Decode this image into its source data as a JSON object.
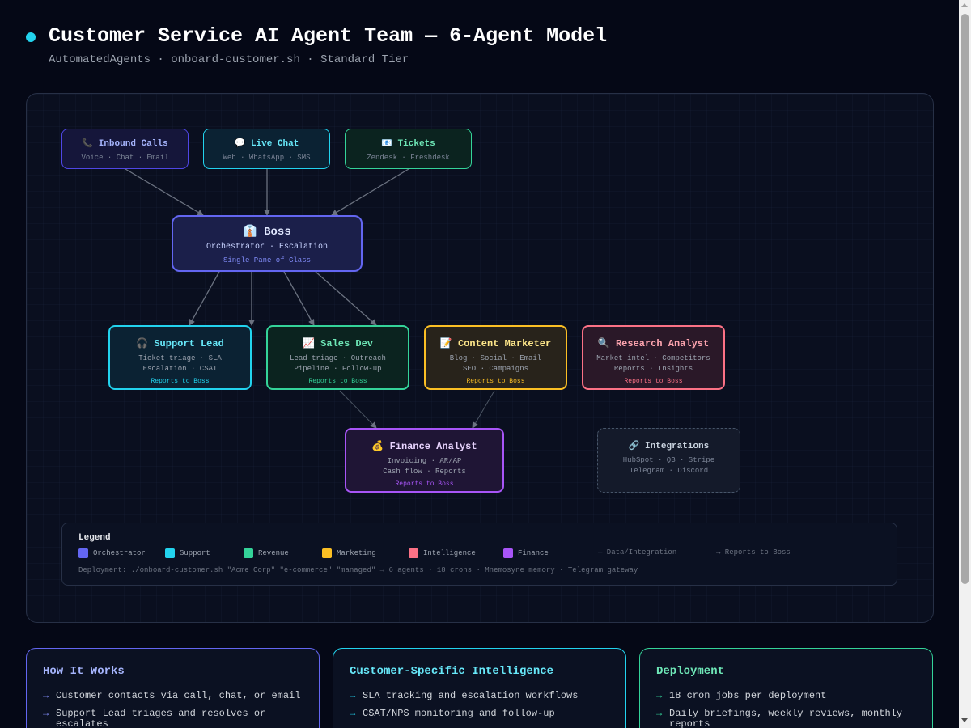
{
  "header": {
    "title": "Customer Service AI Agent Team — 6-Agent Model",
    "subtitle": "AutomatedAgents · onboard-customer.sh · Standard Tier"
  },
  "channels": [
    {
      "icon": "📞",
      "label": "Inbound Calls",
      "sub": "Voice · Chat · Email",
      "color": "#a5b4fc",
      "border": "#4f46e5",
      "bg": "#15163a"
    },
    {
      "icon": "💬",
      "label": "Live Chat",
      "sub": "Web · WhatsApp · SMS",
      "color": "#67e8f9",
      "border": "#22d3ee",
      "bg": "#0b2233"
    },
    {
      "icon": "📧",
      "label": "Tickets",
      "sub": "Zendesk · Freshdesk",
      "color": "#6ee7b7",
      "border": "#34d399",
      "bg": "#0b231f"
    }
  ],
  "boss": {
    "icon": "👔",
    "label": "Boss",
    "sub": "Orchestrator · Escalation",
    "note": "Single Pane of Glass"
  },
  "agents": [
    {
      "icon": "🎧",
      "label": "Support Lead",
      "line1": "Ticket triage · SLA",
      "line2": "Escalation · CSAT",
      "report": "Reports to Boss",
      "color": "#67e8f9",
      "border": "#22d3ee",
      "bg": "#0b2233"
    },
    {
      "icon": "📈",
      "label": "Sales Dev",
      "line1": "Lead triage · Outreach",
      "line2": "Pipeline · Follow-up",
      "report": "Reports to Boss",
      "color": "#6ee7b7",
      "border": "#34d399",
      "bg": "#0b231f"
    },
    {
      "icon": "📝",
      "label": "Content Marketer",
      "line1": "Blog · Social · Email",
      "line2": "SEO · Campaigns",
      "report": "Reports to Boss",
      "color": "#fde68a",
      "border": "#fbbf24",
      "bg": "#28231b"
    },
    {
      "icon": "🔍",
      "label": "Research Analyst",
      "line1": "Market intel · Competitors",
      "line2": "Reports · Insights",
      "report": "Reports to Boss",
      "color": "#fda4af",
      "border": "#fb7185",
      "bg": "#2a1828"
    },
    {
      "icon": "💰",
      "label": "Finance Analyst",
      "line1": "Invoicing · AR/AP",
      "line2": "Cash flow · Reports",
      "report": "Reports to Boss",
      "color": "#e9d5ff",
      "border": "#a855f7",
      "bg": "#1f1535"
    }
  ],
  "integrations": {
    "icon": "🔗",
    "label": "Integrations",
    "line1": "HubSpot · QB · Stripe",
    "line2": "Telegram · Discord"
  },
  "legend": {
    "title": "Legend",
    "items": [
      {
        "label": "Orchestrator",
        "color": "#6366f1"
      },
      {
        "label": "Support",
        "color": "#22d3ee"
      },
      {
        "label": "Revenue",
        "color": "#34d399"
      },
      {
        "label": "Marketing",
        "color": "#fbbf24"
      },
      {
        "label": "Intelligence",
        "color": "#fb7185"
      },
      {
        "label": "Finance",
        "color": "#a855f7"
      }
    ],
    "data_line": "— Data/Integration",
    "reports_line": "→ Reports to Boss",
    "deployment": "Deployment: ./onboard-customer.sh \"Acme Corp\" \"e-commerce\" \"managed\" → 6 agents · 18 crons · Mnemosyne memory · Telegram gateway"
  },
  "cards": [
    {
      "title": "How It Works",
      "color": "#a5b4fc",
      "border": "#6366f1",
      "items": [
        "Customer contacts via call, chat, or email",
        "Support Lead triages and resolves or escalates"
      ]
    },
    {
      "title": "Customer-Specific Intelligence",
      "color": "#67e8f9",
      "border": "#22d3ee",
      "items": [
        "SLA tracking and escalation workflows",
        "CSAT/NPS monitoring and follow-up"
      ]
    },
    {
      "title": "Deployment",
      "color": "#6ee7b7",
      "border": "#34d399",
      "items": [
        "18 cron jobs per deployment",
        "Daily briefings, weekly reviews, monthly reports"
      ]
    }
  ],
  "bullet": "→"
}
